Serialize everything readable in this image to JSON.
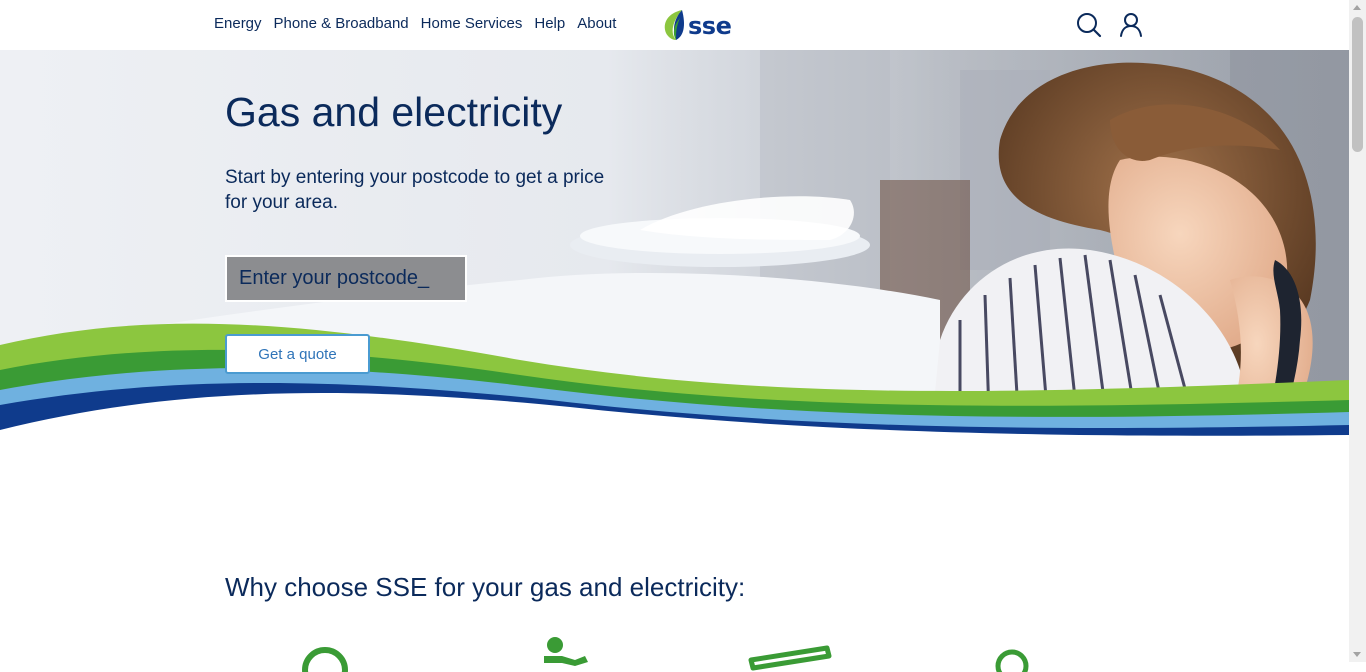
{
  "nav": {
    "items": [
      {
        "label": "Energy"
      },
      {
        "label": "Phone & Broadband"
      },
      {
        "label": "Home Services"
      },
      {
        "label": "Help"
      },
      {
        "label": "About"
      }
    ],
    "logo_text": "sse",
    "icons": [
      "search-icon",
      "account-icon"
    ]
  },
  "hero": {
    "title": "Gas and electricity",
    "subtitle": "Start by entering your postcode to get a price for your area.",
    "postcode_placeholder": "Enter your postcode_",
    "quote_button": "Get a quote"
  },
  "section": {
    "heading": "Why choose SSE for your gas and electricity:",
    "feature_icons": [
      "badge-icon",
      "person-icon",
      "card-icon",
      "location-icon"
    ]
  },
  "colors": {
    "navy": "#0b2a5b",
    "green": "#3a9b35",
    "light_green": "#8cc63f",
    "blue": "#4a9bd1",
    "dark_blue": "#0f3b8c"
  }
}
